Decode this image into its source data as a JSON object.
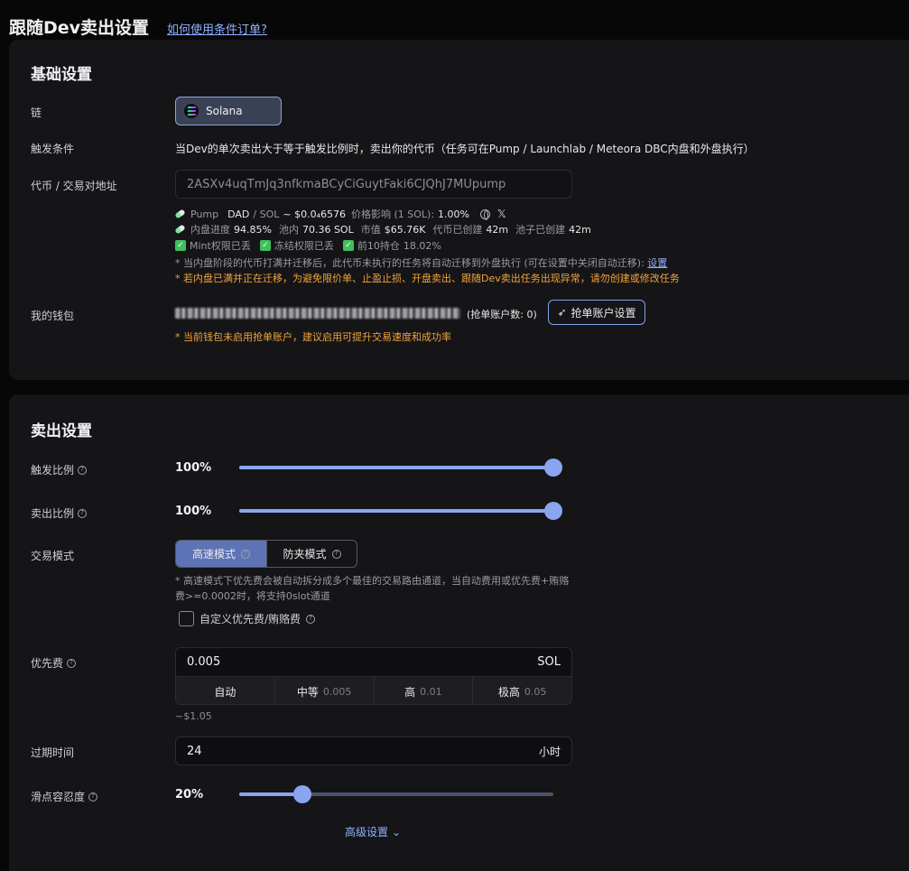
{
  "header": {
    "title": "跟随Dev卖出设置",
    "help_link": "如何使用条件订单?"
  },
  "basic": {
    "title": "基础设置",
    "chain_label": "链",
    "chain_value": "Solana",
    "trigger_label": "触发条件",
    "trigger_desc": "当Dev的单次卖出大于等于触发比例时，卖出你的代币（任务可在Pump / Launchlab / Meteora DBC内盘和外盘执行）",
    "address_label": "代币 / 交易对地址",
    "address_value": "2ASXv4uqTmJq3nfkmaBCyCiGuytFaki6CJQhJ7MUpump",
    "token_info": {
      "platform": "Pump",
      "pair": "DAD",
      "pair_quote": "/ SOL",
      "price": "~ $0.0₄6576",
      "impact_label": "价格影响 (1 SOL):",
      "impact_value": "1.00%",
      "progress_label": "内盘进度",
      "progress_value": "94.85%",
      "pool_label": "池内",
      "pool_value": "70.36 SOL",
      "mcap_label": "市值",
      "mcap_value": "$65.76K",
      "token_age_label": "代币已创建",
      "token_age_value": "42m",
      "pool_age_label": "池子已创建",
      "pool_age_value": "42m",
      "mint_label": "Mint权限已丢",
      "freeze_label": "冻结权限已丢",
      "top10_label": "前10持仓",
      "top10_value": "18.02%"
    },
    "note_migrate": "* 当内盘阶段的代币打满并迁移后，此代币未执行的任务将自动迁移到外盘执行 (可在设置中关闭自动迁移):",
    "note_migrate_link": "设置",
    "note_warning": "* 若内盘已满并正在迁移，为避免限价单、止盈止损、开盘卖出、跟随Dev卖出任务出现异常，请勿创建或修改任务",
    "wallet_label": "我的钱包",
    "grab_count": "(抢单账户数: 0)",
    "grab_btn": "抢单账户设置",
    "wallet_warning": "* 当前钱包未启用抢单账户，建议启用可提升交易速度和成功率"
  },
  "sell": {
    "title": "卖出设置",
    "trigger_ratio_label": "触发比例",
    "trigger_ratio_value": "100%",
    "trigger_ratio_level": 1.0,
    "sell_ratio_label": "卖出比例",
    "sell_ratio_value": "100%",
    "sell_ratio_level": 1.0,
    "mode_label": "交易模式",
    "mode_fast": "高速模式",
    "mode_mev": "防夹模式",
    "mode_note": "* 高速模式下优先费会被自动拆分成多个最佳的交易路由通道，当自动费用或优先费+贿赂费>=0.0002时，将支持0slot通道",
    "custom_fee_label": "自定义优先费/贿赂费",
    "priority_label": "优先费",
    "priority_value": "0.005",
    "priority_unit": "SOL",
    "fee_options": [
      {
        "label": "自动",
        "sub": ""
      },
      {
        "label": "中等",
        "sub": "0.005"
      },
      {
        "label": "高",
        "sub": "0.01"
      },
      {
        "label": "极高",
        "sub": "0.05"
      }
    ],
    "fee_usd": "~$1.05",
    "expire_label": "过期时间",
    "expire_value": "24",
    "expire_unit": "小时",
    "slippage_label": "滑点容忍度",
    "slippage_value": "20%",
    "slippage_level": 0.2,
    "advanced_label": "高级设置"
  }
}
